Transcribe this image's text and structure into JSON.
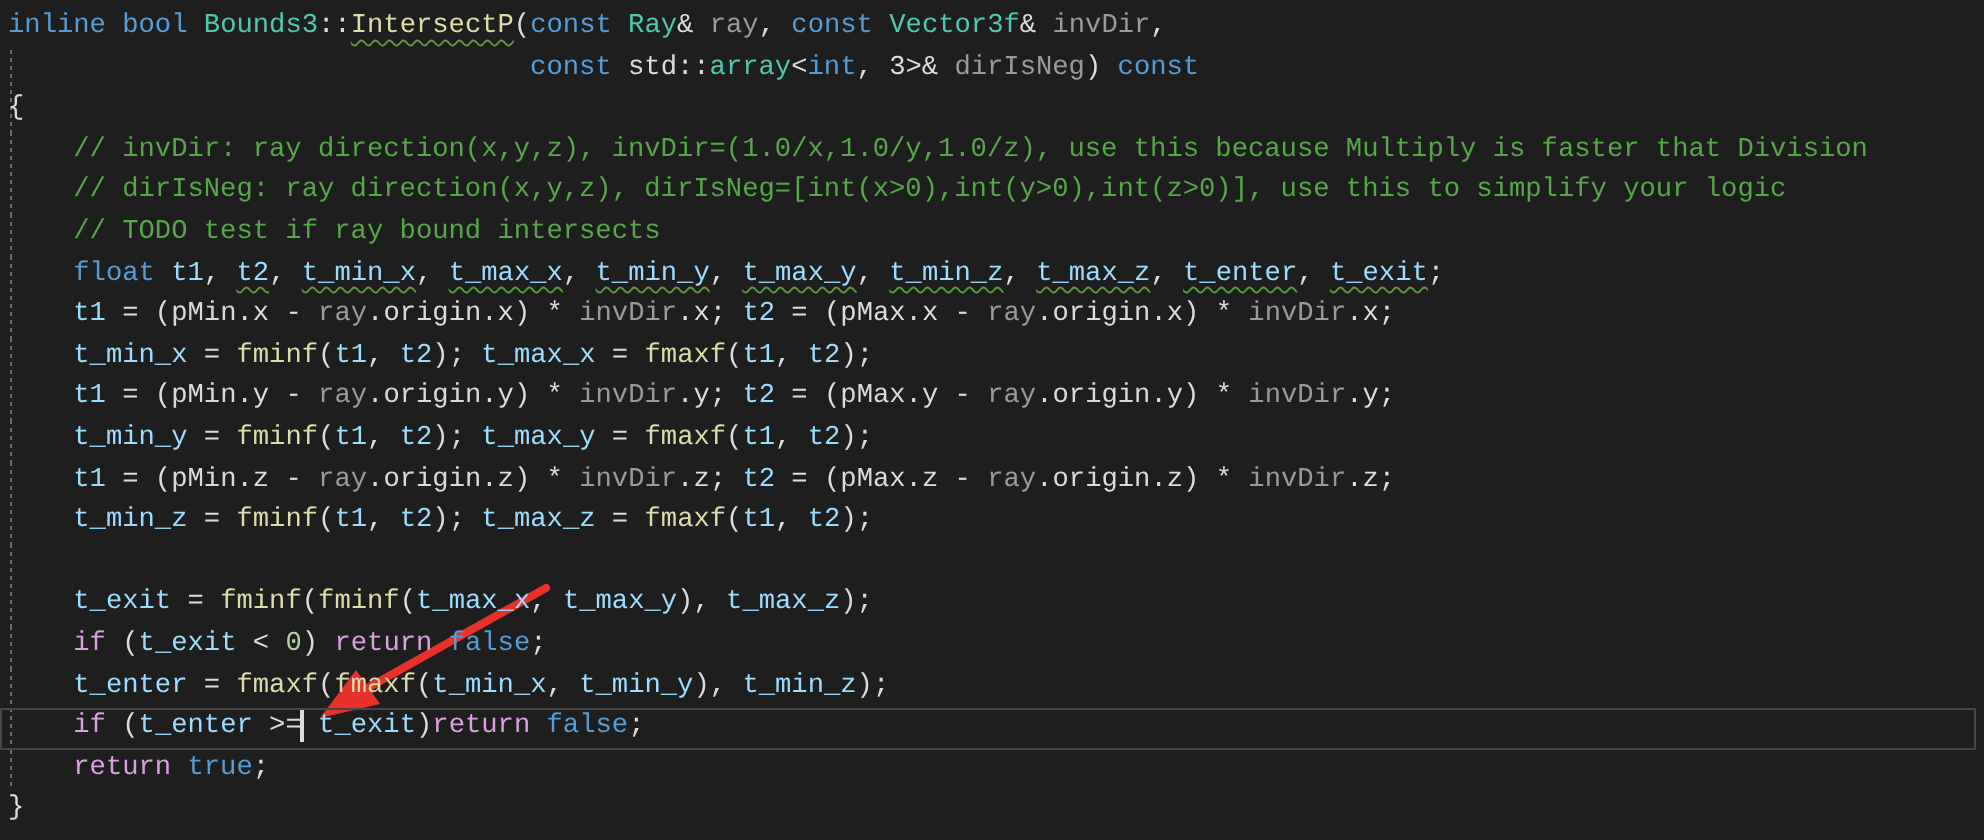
{
  "editor": {
    "lines": [
      {
        "tokens": [
          {
            "kind": "keyword",
            "text": "inline bool "
          },
          {
            "kind": "type",
            "text": "Bounds3"
          },
          {
            "kind": "plain",
            "text": "::"
          },
          {
            "kind": "flaggedfn",
            "text": "IntersectP"
          },
          {
            "kind": "plain",
            "text": "("
          },
          {
            "kind": "keyword",
            "text": "const "
          },
          {
            "kind": "type",
            "text": "Ray"
          },
          {
            "kind": "plain",
            "text": "& "
          },
          {
            "kind": "param",
            "text": "ray"
          },
          {
            "kind": "plain",
            "text": ", "
          },
          {
            "kind": "keyword",
            "text": "const "
          },
          {
            "kind": "type",
            "text": "Vector3f"
          },
          {
            "kind": "plain",
            "text": "& "
          },
          {
            "kind": "param",
            "text": "invDir"
          },
          {
            "kind": "plain",
            "text": ","
          }
        ]
      },
      {
        "tokens": [
          {
            "kind": "keyword",
            "text": "                                const "
          },
          {
            "kind": "plain",
            "text": "std::"
          },
          {
            "kind": "type",
            "text": "array"
          },
          {
            "kind": "plain",
            "text": "<"
          },
          {
            "kind": "keyword",
            "text": "int"
          },
          {
            "kind": "plain",
            "text": ", 3>& "
          },
          {
            "kind": "param",
            "text": "dirIsNeg"
          },
          {
            "kind": "plain",
            "text": ") "
          },
          {
            "kind": "keyword",
            "text": "const"
          }
        ]
      },
      {
        "tokens": [
          {
            "kind": "plain",
            "text": "{"
          }
        ]
      },
      {
        "tokens": [
          {
            "kind": "comment",
            "text": "    // invDir: ray direction(x,y,z), invDir=(1.0/x,1.0/y,1.0/z), use this because Multiply is faster that Division"
          }
        ]
      },
      {
        "tokens": [
          {
            "kind": "comment",
            "text": "    // dirIsNeg: ray direction(x,y,z), dirIsNeg=[int(x>0),int(y>0),int(z>0)], use this to simplify your logic"
          }
        ]
      },
      {
        "tokens": [
          {
            "kind": "comment",
            "text": "    // TODO test if ray bound intersects"
          }
        ]
      },
      {
        "tokens": [
          {
            "kind": "keyword",
            "text": "    float "
          },
          {
            "kind": "variable",
            "text": "t1"
          },
          {
            "kind": "plain",
            "text": ", "
          },
          {
            "kind": "flaggedvar",
            "text": "t2"
          },
          {
            "kind": "plain",
            "text": ", "
          },
          {
            "kind": "flaggedvar",
            "text": "t_min_x"
          },
          {
            "kind": "plain",
            "text": ", "
          },
          {
            "kind": "flaggedvar",
            "text": "t_max_x"
          },
          {
            "kind": "plain",
            "text": ", "
          },
          {
            "kind": "flaggedvar",
            "text": "t_min_y"
          },
          {
            "kind": "plain",
            "text": ", "
          },
          {
            "kind": "flaggedvar",
            "text": "t_max_y"
          },
          {
            "kind": "plain",
            "text": ", "
          },
          {
            "kind": "flaggedvar",
            "text": "t_min_z"
          },
          {
            "kind": "plain",
            "text": ", "
          },
          {
            "kind": "flaggedvar",
            "text": "t_max_z"
          },
          {
            "kind": "plain",
            "text": ", "
          },
          {
            "kind": "flaggedvar",
            "text": "t_enter"
          },
          {
            "kind": "plain",
            "text": ", "
          },
          {
            "kind": "flaggedvar",
            "text": "t_exit"
          },
          {
            "kind": "plain",
            "text": ";"
          }
        ]
      },
      {
        "tokens": [
          {
            "kind": "variable",
            "text": "    t1"
          },
          {
            "kind": "plain",
            "text": " = ("
          },
          {
            "kind": "member",
            "text": "pMin"
          },
          {
            "kind": "plain",
            "text": ".x - "
          },
          {
            "kind": "param",
            "text": "ray"
          },
          {
            "kind": "plain",
            "text": "."
          },
          {
            "kind": "member",
            "text": "origin"
          },
          {
            "kind": "plain",
            "text": ".x) * "
          },
          {
            "kind": "param",
            "text": "invDir"
          },
          {
            "kind": "plain",
            "text": ".x; "
          },
          {
            "kind": "variable",
            "text": "t2"
          },
          {
            "kind": "plain",
            "text": " = ("
          },
          {
            "kind": "member",
            "text": "pMax"
          },
          {
            "kind": "plain",
            "text": ".x - "
          },
          {
            "kind": "param",
            "text": "ray"
          },
          {
            "kind": "plain",
            "text": "."
          },
          {
            "kind": "member",
            "text": "origin"
          },
          {
            "kind": "plain",
            "text": ".x) * "
          },
          {
            "kind": "param",
            "text": "invDir"
          },
          {
            "kind": "plain",
            "text": ".x;"
          }
        ]
      },
      {
        "tokens": [
          {
            "kind": "variable",
            "text": "    t_min_x"
          },
          {
            "kind": "plain",
            "text": " = "
          },
          {
            "kind": "function",
            "text": "fminf"
          },
          {
            "kind": "plain",
            "text": "("
          },
          {
            "kind": "variable",
            "text": "t1"
          },
          {
            "kind": "plain",
            "text": ", "
          },
          {
            "kind": "variable",
            "text": "t2"
          },
          {
            "kind": "plain",
            "text": "); "
          },
          {
            "kind": "variable",
            "text": "t_max_x"
          },
          {
            "kind": "plain",
            "text": " = "
          },
          {
            "kind": "function",
            "text": "fmaxf"
          },
          {
            "kind": "plain",
            "text": "("
          },
          {
            "kind": "variable",
            "text": "t1"
          },
          {
            "kind": "plain",
            "text": ", "
          },
          {
            "kind": "variable",
            "text": "t2"
          },
          {
            "kind": "plain",
            "text": ");"
          }
        ]
      },
      {
        "tokens": [
          {
            "kind": "variable",
            "text": "    t1"
          },
          {
            "kind": "plain",
            "text": " = ("
          },
          {
            "kind": "member",
            "text": "pMin"
          },
          {
            "kind": "plain",
            "text": ".y - "
          },
          {
            "kind": "param",
            "text": "ray"
          },
          {
            "kind": "plain",
            "text": "."
          },
          {
            "kind": "member",
            "text": "origin"
          },
          {
            "kind": "plain",
            "text": ".y) * "
          },
          {
            "kind": "param",
            "text": "invDir"
          },
          {
            "kind": "plain",
            "text": ".y; "
          },
          {
            "kind": "variable",
            "text": "t2"
          },
          {
            "kind": "plain",
            "text": " = ("
          },
          {
            "kind": "member",
            "text": "pMax"
          },
          {
            "kind": "plain",
            "text": ".y - "
          },
          {
            "kind": "param",
            "text": "ray"
          },
          {
            "kind": "plain",
            "text": "."
          },
          {
            "kind": "member",
            "text": "origin"
          },
          {
            "kind": "plain",
            "text": ".y) * "
          },
          {
            "kind": "param",
            "text": "invDir"
          },
          {
            "kind": "plain",
            "text": ".y;"
          }
        ]
      },
      {
        "tokens": [
          {
            "kind": "variable",
            "text": "    t_min_y"
          },
          {
            "kind": "plain",
            "text": " = "
          },
          {
            "kind": "function",
            "text": "fminf"
          },
          {
            "kind": "plain",
            "text": "("
          },
          {
            "kind": "variable",
            "text": "t1"
          },
          {
            "kind": "plain",
            "text": ", "
          },
          {
            "kind": "variable",
            "text": "t2"
          },
          {
            "kind": "plain",
            "text": "); "
          },
          {
            "kind": "variable",
            "text": "t_max_y"
          },
          {
            "kind": "plain",
            "text": " = "
          },
          {
            "kind": "function",
            "text": "fmaxf"
          },
          {
            "kind": "plain",
            "text": "("
          },
          {
            "kind": "variable",
            "text": "t1"
          },
          {
            "kind": "plain",
            "text": ", "
          },
          {
            "kind": "variable",
            "text": "t2"
          },
          {
            "kind": "plain",
            "text": ");"
          }
        ]
      },
      {
        "tokens": [
          {
            "kind": "variable",
            "text": "    t1"
          },
          {
            "kind": "plain",
            "text": " = ("
          },
          {
            "kind": "member",
            "text": "pMin"
          },
          {
            "kind": "plain",
            "text": ".z - "
          },
          {
            "kind": "param",
            "text": "ray"
          },
          {
            "kind": "plain",
            "text": "."
          },
          {
            "kind": "member",
            "text": "origin"
          },
          {
            "kind": "plain",
            "text": ".z) * "
          },
          {
            "kind": "param",
            "text": "invDir"
          },
          {
            "kind": "plain",
            "text": ".z; "
          },
          {
            "kind": "variable",
            "text": "t2"
          },
          {
            "kind": "plain",
            "text": " = ("
          },
          {
            "kind": "member",
            "text": "pMax"
          },
          {
            "kind": "plain",
            "text": ".z - "
          },
          {
            "kind": "param",
            "text": "ray"
          },
          {
            "kind": "plain",
            "text": "."
          },
          {
            "kind": "member",
            "text": "origin"
          },
          {
            "kind": "plain",
            "text": ".z) * "
          },
          {
            "kind": "param",
            "text": "invDir"
          },
          {
            "kind": "plain",
            "text": ".z;"
          }
        ]
      },
      {
        "tokens": [
          {
            "kind": "variable",
            "text": "    t_min_z"
          },
          {
            "kind": "plain",
            "text": " = "
          },
          {
            "kind": "function",
            "text": "fminf"
          },
          {
            "kind": "plain",
            "text": "("
          },
          {
            "kind": "variable",
            "text": "t1"
          },
          {
            "kind": "plain",
            "text": ", "
          },
          {
            "kind": "variable",
            "text": "t2"
          },
          {
            "kind": "plain",
            "text": "); "
          },
          {
            "kind": "variable",
            "text": "t_max_z"
          },
          {
            "kind": "plain",
            "text": " = "
          },
          {
            "kind": "function",
            "text": "fmaxf"
          },
          {
            "kind": "plain",
            "text": "("
          },
          {
            "kind": "variable",
            "text": "t1"
          },
          {
            "kind": "plain",
            "text": ", "
          },
          {
            "kind": "variable",
            "text": "t2"
          },
          {
            "kind": "plain",
            "text": ");"
          }
        ]
      },
      {
        "current": false
      },
      {
        "tokens": [
          {
            "kind": "variable",
            "text": "    t_exit"
          },
          {
            "kind": "plain",
            "text": " = "
          },
          {
            "kind": "function",
            "text": "fminf"
          },
          {
            "kind": "plain",
            "text": "("
          },
          {
            "kind": "function",
            "text": "fminf"
          },
          {
            "kind": "plain",
            "text": "("
          },
          {
            "kind": "variable",
            "text": "t_max_x"
          },
          {
            "kind": "plain",
            "text": ", "
          },
          {
            "kind": "variable",
            "text": "t_max_y"
          },
          {
            "kind": "plain",
            "text": "), "
          },
          {
            "kind": "variable",
            "text": "t_max_z"
          },
          {
            "kind": "plain",
            "text": ");"
          }
        ]
      },
      {
        "tokens": [
          {
            "kind": "control",
            "text": "    if"
          },
          {
            "kind": "plain",
            "text": " ("
          },
          {
            "kind": "variable",
            "text": "t_exit"
          },
          {
            "kind": "plain",
            "text": " < "
          },
          {
            "kind": "number",
            "text": "0"
          },
          {
            "kind": "plain",
            "text": ") "
          },
          {
            "kind": "control",
            "text": "return"
          },
          {
            "kind": "keyword",
            "text": " false"
          },
          {
            "kind": "plain",
            "text": ";"
          }
        ]
      },
      {
        "tokens": [
          {
            "kind": "variable",
            "text": "    t_enter"
          },
          {
            "kind": "plain",
            "text": " = "
          },
          {
            "kind": "function",
            "text": "fmaxf"
          },
          {
            "kind": "plain",
            "text": "("
          },
          {
            "kind": "function",
            "text": "fmaxf"
          },
          {
            "kind": "plain",
            "text": "("
          },
          {
            "kind": "variable",
            "text": "t_min_x"
          },
          {
            "kind": "plain",
            "text": ", "
          },
          {
            "kind": "variable",
            "text": "t_min_y"
          },
          {
            "kind": "plain",
            "text": "), "
          },
          {
            "kind": "variable",
            "text": "t_min_z"
          },
          {
            "kind": "plain",
            "text": ");"
          }
        ]
      },
      {
        "current": true,
        "tokens": [
          {
            "kind": "control",
            "text": "    if"
          },
          {
            "kind": "plain",
            "text": " ("
          },
          {
            "kind": "variable",
            "text": "t_enter"
          },
          {
            "kind": "plain",
            "text": " >="
          },
          {
            "kind": "caret"
          },
          {
            "kind": "variable",
            "text": " t_exit"
          },
          {
            "kind": "plain",
            "text": ")"
          },
          {
            "kind": "control",
            "text": "return"
          },
          {
            "kind": "keyword",
            "text": " false"
          },
          {
            "kind": "plain",
            "text": ";"
          }
        ]
      },
      {
        "tokens": [
          {
            "kind": "control",
            "text": "    return"
          },
          {
            "kind": "keyword",
            "text": " true"
          },
          {
            "kind": "plain",
            "text": ";"
          }
        ]
      },
      {
        "tokens": [
          {
            "kind": "plain",
            "text": "}"
          }
        ]
      }
    ]
  }
}
